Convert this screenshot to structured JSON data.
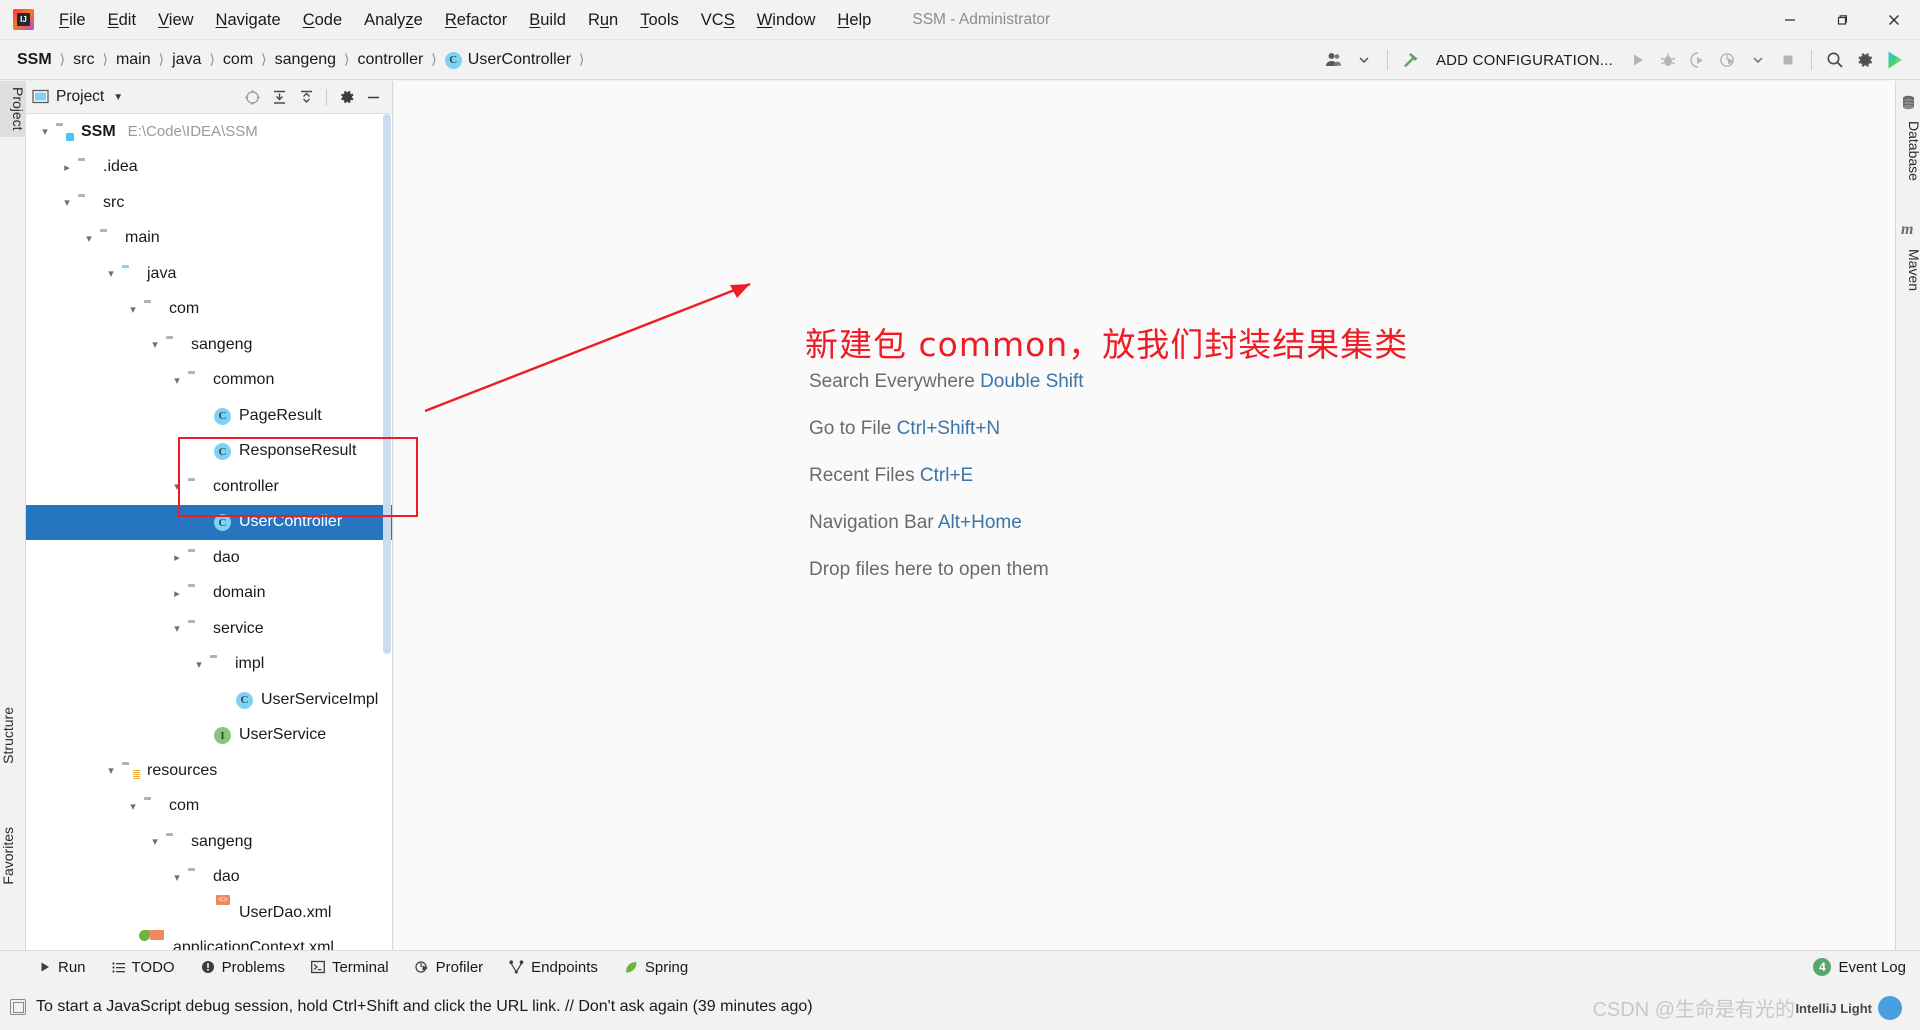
{
  "window": {
    "title": "SSM - Administrator",
    "minimize_label": "─",
    "maximize_label": "❐",
    "close_label": "✕"
  },
  "menubar": {
    "logo_name": "intellij-idea-logo",
    "items": [
      {
        "label": "File",
        "mnemonic": "F"
      },
      {
        "label": "Edit",
        "mnemonic": "E"
      },
      {
        "label": "View",
        "mnemonic": "V"
      },
      {
        "label": "Navigate",
        "mnemonic": "N"
      },
      {
        "label": "Code",
        "mnemonic": "C"
      },
      {
        "label": "Analyze",
        "mnemonic": "z"
      },
      {
        "label": "Refactor",
        "mnemonic": "R"
      },
      {
        "label": "Build",
        "mnemonic": "B"
      },
      {
        "label": "Run",
        "mnemonic": "u"
      },
      {
        "label": "Tools",
        "mnemonic": "T"
      },
      {
        "label": "VCS",
        "mnemonic": "S"
      },
      {
        "label": "Window",
        "mnemonic": "W"
      },
      {
        "label": "Help",
        "mnemonic": "H"
      }
    ]
  },
  "navbar": {
    "breadcrumbs": [
      {
        "label": "SSM",
        "icon": "",
        "bold": true
      },
      {
        "label": "src",
        "icon": "",
        "bold": false
      },
      {
        "label": "main",
        "icon": "",
        "bold": false
      },
      {
        "label": "java",
        "icon": "",
        "bold": false
      },
      {
        "label": "com",
        "icon": "",
        "bold": false
      },
      {
        "label": "sangeng",
        "icon": "",
        "bold": false
      },
      {
        "label": "controller",
        "icon": "",
        "bold": false
      },
      {
        "label": "UserController",
        "icon": "class-icon",
        "bold": false
      }
    ],
    "separator": "❯",
    "add_configuration_label": "ADD CONFIGURATION...",
    "icons": [
      "user-account-icon",
      "build-hammer-icon",
      "run-icon",
      "debug-icon",
      "run-coverage-icon",
      "profiler-icon",
      "stop-icon",
      "search-icon",
      "settings-gear-icon",
      "idea-assistant-icon"
    ]
  },
  "left_tool_strip": {
    "tabs": [
      {
        "label": "Project",
        "selected": true
      },
      {
        "label": "Structure",
        "selected": false
      },
      {
        "label": "Favorites",
        "selected": false
      }
    ]
  },
  "right_tool_strip": {
    "tabs": [
      {
        "label": "Database",
        "icon": "database-icon"
      },
      {
        "label": "Maven",
        "icon": "maven-icon"
      }
    ]
  },
  "project_panel": {
    "title": "Project",
    "header_icons": [
      "select-opened-file-icon",
      "expand-all-icon",
      "collapse-all-icon",
      "settings-gear-icon",
      "hide-panel-icon"
    ],
    "tree": [
      {
        "label": "SSM",
        "path": "E:\\Code\\IDEA\\SSM",
        "indent": 0,
        "arrow": "down",
        "icon": "project-folder-icon",
        "bold": true,
        "selected": false
      },
      {
        "label": ".idea",
        "path": "",
        "indent": 1,
        "arrow": "right",
        "icon": "folder-icon",
        "bold": false,
        "selected": false
      },
      {
        "label": "src",
        "path": "",
        "indent": 1,
        "arrow": "down",
        "icon": "folder-icon",
        "bold": false,
        "selected": false
      },
      {
        "label": "main",
        "path": "",
        "indent": 2,
        "arrow": "down",
        "icon": "folder-icon",
        "bold": false,
        "selected": false
      },
      {
        "label": "java",
        "path": "",
        "indent": 3,
        "arrow": "down",
        "icon": "source-root-icon",
        "bold": false,
        "selected": false
      },
      {
        "label": "com",
        "path": "",
        "indent": 4,
        "arrow": "down",
        "icon": "package-icon",
        "bold": false,
        "selected": false
      },
      {
        "label": "sangeng",
        "path": "",
        "indent": 5,
        "arrow": "down",
        "icon": "package-icon",
        "bold": false,
        "selected": false
      },
      {
        "label": "common",
        "path": "",
        "indent": 6,
        "arrow": "down",
        "icon": "package-icon",
        "bold": false,
        "selected": false
      },
      {
        "label": "PageResult",
        "path": "",
        "indent": 7,
        "arrow": "none",
        "icon": "class-icon",
        "bold": false,
        "selected": false
      },
      {
        "label": "ResponseResult",
        "path": "",
        "indent": 7,
        "arrow": "none",
        "icon": "class-icon",
        "bold": false,
        "selected": false
      },
      {
        "label": "controller",
        "path": "",
        "indent": 6,
        "arrow": "down",
        "icon": "package-icon",
        "bold": false,
        "selected": false
      },
      {
        "label": "UserController",
        "path": "",
        "indent": 7,
        "arrow": "none",
        "icon": "class-icon",
        "bold": false,
        "selected": true
      },
      {
        "label": "dao",
        "path": "",
        "indent": 6,
        "arrow": "right",
        "icon": "package-icon",
        "bold": false,
        "selected": false
      },
      {
        "label": "domain",
        "path": "",
        "indent": 6,
        "arrow": "right",
        "icon": "package-icon",
        "bold": false,
        "selected": false
      },
      {
        "label": "service",
        "path": "",
        "indent": 6,
        "arrow": "down",
        "icon": "package-icon",
        "bold": false,
        "selected": false
      },
      {
        "label": "impl",
        "path": "",
        "indent": 7,
        "arrow": "down",
        "icon": "package-icon",
        "bold": false,
        "selected": false
      },
      {
        "label": "UserServiceImpl",
        "path": "",
        "indent": 8,
        "arrow": "none",
        "icon": "class-icon",
        "bold": false,
        "selected": false
      },
      {
        "label": "UserService",
        "path": "",
        "indent": 7,
        "arrow": "none",
        "icon": "interface-icon",
        "bold": false,
        "selected": false
      },
      {
        "label": "resources",
        "path": "",
        "indent": 3,
        "arrow": "down",
        "icon": "resource-root-icon",
        "bold": false,
        "selected": false
      },
      {
        "label": "com",
        "path": "",
        "indent": 4,
        "arrow": "down",
        "icon": "folder-icon",
        "bold": false,
        "selected": false
      },
      {
        "label": "sangeng",
        "path": "",
        "indent": 5,
        "arrow": "down",
        "icon": "folder-icon",
        "bold": false,
        "selected": false
      },
      {
        "label": "dao",
        "path": "",
        "indent": 6,
        "arrow": "down",
        "icon": "folder-icon",
        "bold": false,
        "selected": false
      },
      {
        "label": "UserDao.xml",
        "path": "",
        "indent": 7,
        "arrow": "none",
        "icon": "xml-file-icon",
        "bold": false,
        "selected": false
      },
      {
        "label": "applicationContext.xml",
        "path": "",
        "indent": 4,
        "arrow": "none",
        "icon": "spring-xml-file-icon",
        "bold": false,
        "selected": false
      }
    ],
    "class_icon_letter": "C",
    "interface_icon_letter": "I"
  },
  "editor": {
    "annotation": "新建包 common，放我们封装结果集类",
    "annotation_color": "#ee1c25",
    "hints": [
      {
        "action": "Search Everywhere",
        "key": "Double Shift"
      },
      {
        "action": "Go to File",
        "key": "Ctrl+Shift+N"
      },
      {
        "action": "Recent Files",
        "key": "Ctrl+E"
      },
      {
        "action": "Navigation Bar",
        "key": "Alt+Home"
      },
      {
        "action": "Drop files here to open them",
        "key": ""
      }
    ]
  },
  "bottom_bar": {
    "items": [
      {
        "label": "Run",
        "icon": "run-icon"
      },
      {
        "label": "TODO",
        "icon": "todo-list-icon"
      },
      {
        "label": "Problems",
        "icon": "problems-icon"
      },
      {
        "label": "Terminal",
        "icon": "terminal-icon"
      },
      {
        "label": "Profiler",
        "icon": "profiler-icon"
      },
      {
        "label": "Endpoints",
        "icon": "endpoints-icon"
      },
      {
        "label": "Spring",
        "icon": "spring-leaf-icon"
      }
    ],
    "event_log": {
      "label": "Event Log",
      "count": "4",
      "badge_color": "#59a869"
    }
  },
  "status_bar": {
    "message": "To start a JavaScript debug session, hold Ctrl+Shift and click the URL link. // Don't ask again (39 minutes ago)",
    "watermark": "CSDN @生命是有光的",
    "theme_indicator": "IntelliJ Light"
  }
}
